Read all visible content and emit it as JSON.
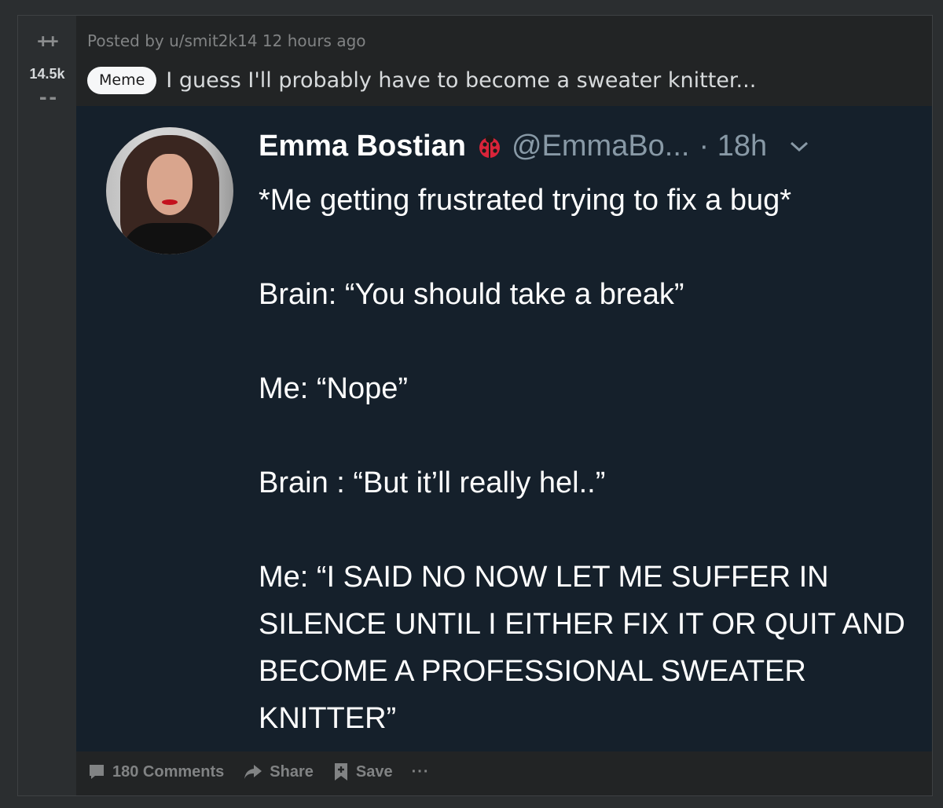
{
  "vote": {
    "up_label": "++",
    "count": "14.5k",
    "down_label": "--"
  },
  "post": {
    "meta": "Posted by u/smit2k14 12 hours ago",
    "flair": "Meme",
    "title": "I guess I'll probably have to become a sweater knitter..."
  },
  "tweet": {
    "name": "Emma Bostian",
    "name_emoji_icon": "ladybug-icon",
    "handle": "@EmmaBo...",
    "time": "· 18h",
    "lines": [
      "*Me getting frustrated trying to fix a bug*",
      "Brain: “You should take a break”",
      "Me: “Nope”",
      "Brain : “But it’ll really hel..”",
      "Me: “I SAID NO NOW LET ME SUFFER IN SILENCE UNTIL I EITHER FIX IT OR QUIT AND BECOME A PROFESSIONAL SWEATER KNITTER”"
    ]
  },
  "actions": {
    "comments": "180 Comments",
    "share": "Share",
    "save": "Save",
    "more": "···"
  },
  "colors": {
    "page_bg": "#2b2e30",
    "card_bg": "#222425",
    "tweet_bg": "#15202b",
    "muted_text": "#818384",
    "tweet_meta": "#8899a6"
  }
}
